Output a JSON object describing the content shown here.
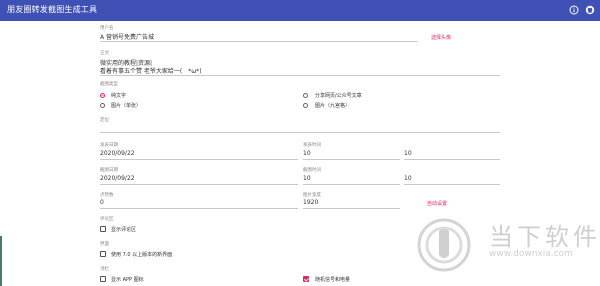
{
  "app": {
    "title": "朋友圈转发截图生成工具"
  },
  "icons": {
    "info": "info-icon",
    "github": "github-icon"
  },
  "colors": {
    "primary": "#3f51b5",
    "accent": "#e91e63"
  },
  "form": {
    "username": {
      "label": "用户名",
      "value": "A 营销号免费广告城",
      "action": "选择头像"
    },
    "body": {
      "label": "正文",
      "line1": "微实用的教程|资源|",
      "line2": "看着有事五个赞 老爷大家给一(　*ω*)"
    },
    "screenshot_type": {
      "label": "截图类型",
      "options": [
        {
          "label": "纯文字",
          "selected": true
        },
        {
          "label": "分享网页/公众号文章",
          "selected": false
        },
        {
          "label": "图片（单张）",
          "selected": false
        },
        {
          "label": "图片（九宫格）",
          "selected": false
        }
      ]
    },
    "location": {
      "label": "定位",
      "value": ""
    },
    "post_date": {
      "label": "发表日期",
      "value": "2020/09/22"
    },
    "post_time": {
      "label": "发表时间",
      "hour": "10",
      "minute": "10"
    },
    "shot_date": {
      "label": "截图日期",
      "value": "2020/09/22"
    },
    "shot_time": {
      "label": "截图时间",
      "hour": "10",
      "minute": "10"
    },
    "likes": {
      "label": "点赞数",
      "value": "0"
    },
    "image_width": {
      "label": "图片宽度",
      "value": "1920",
      "action": "自动设置"
    },
    "comments": {
      "label": "评论区",
      "option": "显示评论区",
      "checked": false
    },
    "interface": {
      "label": "界面",
      "option": "使用 7.0 以上版本的新界面",
      "checked": false
    },
    "top_bar": {
      "label": "顶栏",
      "option1": "显示 APP 图标",
      "option1_checked": false,
      "option2": "随机信号和电量",
      "option2_checked": true
    }
  },
  "watermark": {
    "text": "当下软件园",
    "url": "www.downxia.com"
  }
}
